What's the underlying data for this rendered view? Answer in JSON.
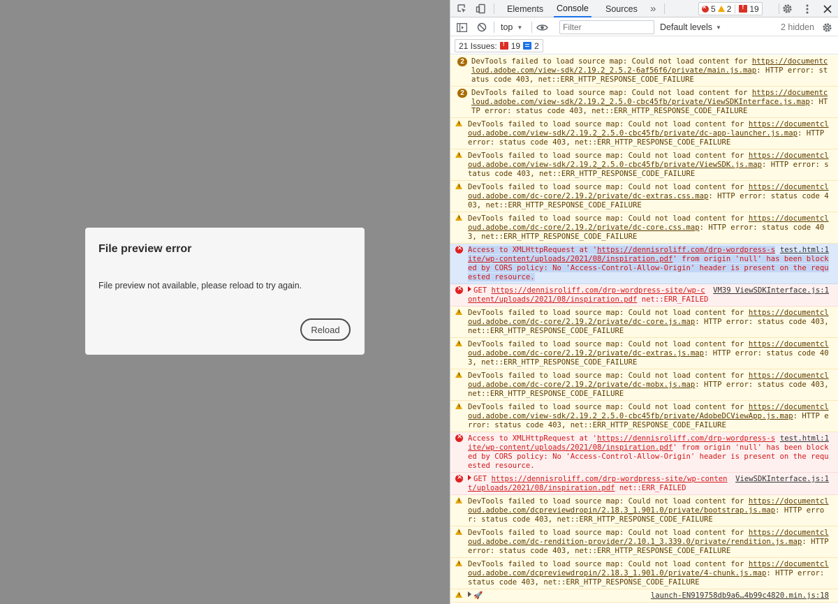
{
  "viewport": {
    "dialog": {
      "title": "File preview error",
      "message": "File preview not available, please reload to try again.",
      "reload_label": "Reload"
    }
  },
  "devtools": {
    "tabs": [
      "Elements",
      "Console",
      "Sources"
    ],
    "active_tab": "Console",
    "more_tabs": "»",
    "error_count": "5",
    "warning_count": "2",
    "issue_count": "19",
    "context": "top",
    "filter_placeholder": "Filter",
    "levels_label": "Default levels",
    "hidden_label": "2 hidden",
    "issues_label": "21 Issues:",
    "issues_errors": "19",
    "issues_info": "2"
  },
  "colors": {
    "viewport_bg": "#8c8c8c",
    "warning_bg": "#fffbe5",
    "error_bg": "#fff0f0",
    "selected_bg": "#dce9fb",
    "accent": "#1a73e8"
  },
  "messages": [
    {
      "level": "warning",
      "count": "2",
      "pre": "DevTools failed to load source map: Could not load content for ",
      "url": "https://documentcloud.adobe.com/view-sdk/2.19.2_2.5.2-6af56f6/private/main.js.map",
      "post": ": HTTP error: status code 403, net::ERR_HTTP_RESPONSE_CODE_FAILURE"
    },
    {
      "level": "warning",
      "count": "2",
      "pre": "DevTools failed to load source map: Could not load content for ",
      "url": "https://documentcloud.adobe.com/view-sdk/2.19.2_2.5.0-cbc45fb/private/ViewSDKInterface.js.map",
      "post": ": HTTP error: status code 403, net::ERR_HTTP_RESPONSE_CODE_FAILURE"
    },
    {
      "level": "warning",
      "pre": "DevTools failed to load source map: Could not load content for ",
      "url": "https://documentcloud.adobe.com/view-sdk/2.19.2_2.5.0-cbc45fb/private/dc-app-launcher.js.map",
      "post": ": HTTP error: status code 403, net::ERR_HTTP_RESPONSE_CODE_FAILURE"
    },
    {
      "level": "warning",
      "pre": "DevTools failed to load source map: Could not load content for ",
      "url": "https://documentcloud.adobe.com/view-sdk/2.19.2_2.5.0-cbc45fb/private/ViewSDK.js.map",
      "post": ": HTTP error: status code 403, net::ERR_HTTP_RESPONSE_CODE_FAILURE"
    },
    {
      "level": "warning",
      "pre": "DevTools failed to load source map: Could not load content for ",
      "url": "https://documentcloud.adobe.com/dc-core/2.19.2/private/dc-extras.css.map",
      "post": ": HTTP error: status code 403, net::ERR_HTTP_RESPONSE_CODE_FAILURE"
    },
    {
      "level": "warning",
      "pre": "DevTools failed to load source map: Could not load content for ",
      "url": "https://documentcloud.adobe.com/dc-core/2.19.2/private/dc-core.css.map",
      "post": ": HTTP error: status code 403, net::ERR_HTTP_RESPONSE_CODE_FAILURE"
    },
    {
      "level": "error",
      "selected": true,
      "pre": "Access to XMLHttpRequest at '",
      "url": "https://dennisroliff.com/drp-wordpress-site/wp-content/uploads/2021/08/inspiration.pdf",
      "post": "' from origin 'null' has been blocked by CORS policy: No 'Access-Control-Allow-Origin' header is present on the requested resource.",
      "source": "test.html:1"
    },
    {
      "level": "error",
      "get": true,
      "pre": "GET ",
      "url": "https://dennisroliff.com/drp-wordpress-site/wp-content/uploads/2021/08/inspiration.pdf",
      "post": " net::ERR_FAILED",
      "source": "VM39 ViewSDKInterface.js:1"
    },
    {
      "level": "warning",
      "pre": "DevTools failed to load source map: Could not load content for ",
      "url": "https://documentcloud.adobe.com/dc-core/2.19.2/private/dc-core.js.map",
      "post": ": HTTP error: status code 403, net::ERR_HTTP_RESPONSE_CODE_FAILURE"
    },
    {
      "level": "warning",
      "pre": "DevTools failed to load source map: Could not load content for ",
      "url": "https://documentcloud.adobe.com/dc-core/2.19.2/private/dc-extras.js.map",
      "post": ": HTTP error: status code 403, net::ERR_HTTP_RESPONSE_CODE_FAILURE"
    },
    {
      "level": "warning",
      "pre": "DevTools failed to load source map: Could not load content for ",
      "url": "https://documentcloud.adobe.com/dc-core/2.19.2/private/dc-mobx.js.map",
      "post": ": HTTP error: status code 403, net::ERR_HTTP_RESPONSE_CODE_FAILURE"
    },
    {
      "level": "warning",
      "pre": "DevTools failed to load source map: Could not load content for ",
      "url": "https://documentcloud.adobe.com/view-sdk/2.19.2_2.5.0-cbc45fb/private/AdobeDCViewApp.js.map",
      "post": ": HTTP error: status code 403, net::ERR_HTTP_RESPONSE_CODE_FAILURE"
    },
    {
      "level": "error",
      "pre": "Access to XMLHttpRequest at '",
      "url": "https://dennisroliff.com/drp-wordpress-site/wp-content/uploads/2021/08/inspiration.pdf",
      "post": "' from origin 'null' has been blocked by CORS policy: No 'Access-Control-Allow-Origin' header is present on the requested resource.",
      "source": "test.html:1"
    },
    {
      "level": "error",
      "get": true,
      "pre": "GET ",
      "url": "https://dennisroliff.com/drp-wordpress-site/wp-content/uploads/2021/08/inspiration.pdf",
      "post": " net::ERR_FAILED",
      "source": "ViewSDKInterface.js:1"
    },
    {
      "level": "warning",
      "pre": "DevTools failed to load source map: Could not load content for ",
      "url": "https://documentcloud.adobe.com/dcpreviewdropin/2.18.3_1.901.0/private/bootstrap.js.map",
      "post": ": HTTP error: status code 403, net::ERR_HTTP_RESPONSE_CODE_FAILURE"
    },
    {
      "level": "warning",
      "pre": "DevTools failed to load source map: Could not load content for ",
      "url": "https://documentcloud.adobe.com/dc-rendition-provider/2.10.1_3.339.0/private/rendition.js.map",
      "post": ": HTTP error: status code 403, net::ERR_HTTP_RESPONSE_CODE_FAILURE"
    },
    {
      "level": "warning",
      "pre": "DevTools failed to load source map: Could not load content for ",
      "url": "https://documentcloud.adobe.com/dcpreviewdropin/2.18.3_1.901.0/private/4-chunk.js.map",
      "post": ": HTTP error: status code 403, net::ERR_HTTP_RESPONSE_CODE_FAILURE"
    },
    {
      "level": "warning",
      "get": true,
      "pre": "🚀 ",
      "url": "",
      "post": "",
      "source": "launch-EN919758db9a6…4b99c4820.min.js:18"
    }
  ]
}
